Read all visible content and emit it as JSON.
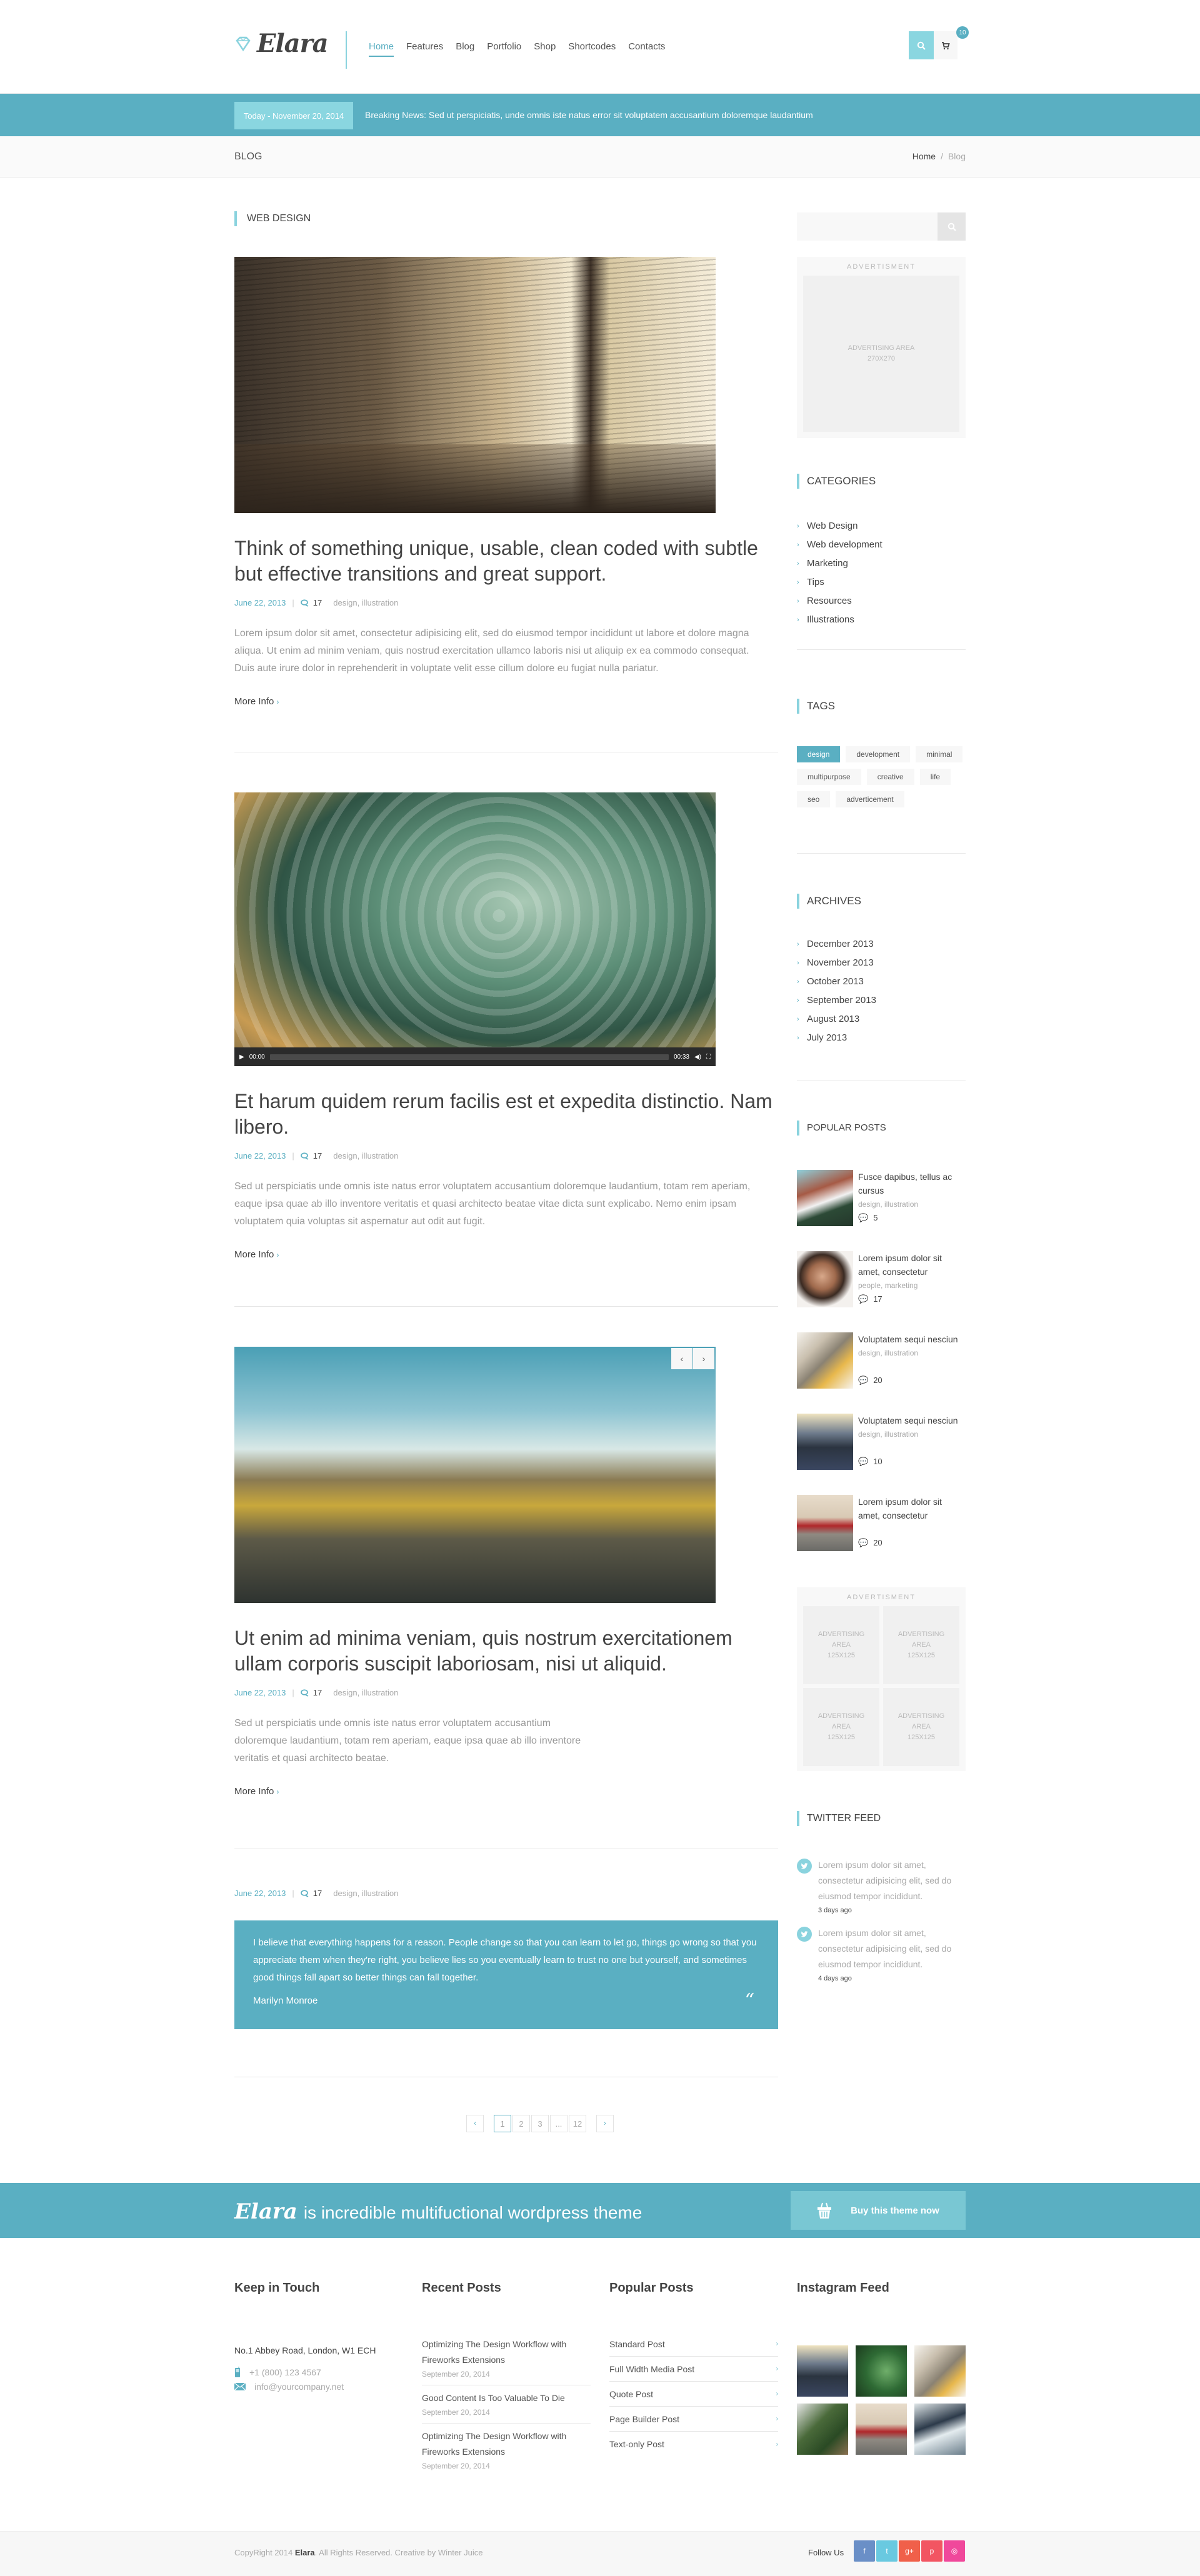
{
  "header": {
    "logo_text": "Elara",
    "nav": [
      "Home",
      "Features",
      "Blog",
      "Portfolio",
      "Shop",
      "Shortcodes",
      "Contacts"
    ],
    "active_nav": "Home",
    "cart_count": "10"
  },
  "news": {
    "today": "Today - November 20, 2014",
    "breaking": "Breaking News: Sed ut perspiciatis, unde omnis iste natus error sit voluptatem accusantium doloremque laudantium"
  },
  "titlebar": {
    "title": "BLOG",
    "breadcrumb": [
      "Home",
      "Blog"
    ],
    "separator": "/"
  },
  "main": {
    "section_title": "WEB DESIGN",
    "more_label": "More Info",
    "posts": [
      {
        "title": "Think of something unique, usable, clean coded with subtle but effective transitions and great support.",
        "date": "June 22, 2013",
        "comments": "17",
        "tags": "design, illustration",
        "excerpt": "Lorem ipsum dolor sit amet, consectetur adipisicing elit, sed do eiusmod tempor incididunt ut labore et dolore magna aliqua. Ut enim ad minim veniam, quis nostrud exercitation ullamco laboris nisi ut aliquip ex ea commodo consequat. Duis aute irure dolor in reprehenderit in voluptate velit esse cillum dolore eu fugiat nulla pariatur."
      },
      {
        "title": "Et harum quidem rerum facilis est et expedita distinctio. Nam libero.",
        "date": "June 22, 2013",
        "comments": "17",
        "tags": "design, illustration",
        "excerpt": "Sed ut perspiciatis unde omnis iste natus error voluptatem accusantium doloremque laudantium, totam rem aperiam, eaque ipsa quae ab illo inventore veritatis et quasi architecto beatae  vitae dicta sunt explicabo. Nemo enim ipsam voluptatem quia voluptas sit aspernatur aut odit aut fugit.",
        "video": {
          "current": "00:00",
          "duration": "00:33",
          "progress": 0
        }
      },
      {
        "title": "Ut enim ad minima veniam, quis nostrum exercitationem ullam corporis suscipit laboriosam, nisi ut aliquid.",
        "date": "June 22, 2013",
        "comments": "17",
        "tags": "design, illustration",
        "excerpt": "Sed ut perspiciatis unde omnis iste natus error voluptatem accusantium doloremque laudantium, totam rem aperiam, eaque ipsa quae ab illo inventore veritatis et quasi architecto beatae."
      },
      {
        "date": "June 22, 2013",
        "comments": "17",
        "tags": "design, illustration",
        "quote": "I believe that everything happens for a reason. People change so that you can learn to let go, things go wrong so that you appreciate them when they're right, you believe lies so you eventually learn to trust no one but yourself, and sometimes good things fall apart so better things can fall together.",
        "author": "Marilyn Monroe"
      }
    ],
    "pagination": {
      "prev": "‹",
      "pages": [
        "1",
        "2",
        "3",
        "...",
        "12"
      ],
      "current": "1",
      "next": "›"
    }
  },
  "sidebar": {
    "search_placeholder": "",
    "ad_label": "ADVERTISMENT",
    "ad_big": [
      "ADVERTISING AREA",
      "270X270"
    ],
    "ad_small": [
      "ADVERTISING",
      "AREA",
      "125X125"
    ],
    "categories_title": "CATEGORIES",
    "categories": [
      "Web Design",
      "Web development",
      "Marketing",
      "Tips",
      "Resources",
      "Illustrations"
    ],
    "tags_title": "TAGS",
    "tags": [
      "design",
      "development",
      "minimal",
      "multipurpose",
      "creative",
      "life",
      "seo",
      "adverticement"
    ],
    "active_tag": "design",
    "archives_title": "ARCHIVES",
    "archives": [
      "December 2013",
      "November 2013",
      "October 2013",
      "September 2013",
      "August 2013",
      "July 2013"
    ],
    "popular_title": "POPULAR POSTS",
    "popular": [
      {
        "title": "Fusce dapibus, tellus ac cursus",
        "cat": "design, illustration",
        "comments": "5"
      },
      {
        "title": "Lorem ipsum dolor sit amet, consectetur",
        "cat": "people, marketing",
        "comments": "17"
      },
      {
        "title": "Voluptatem sequi nesciun",
        "cat": "design, illustration",
        "comments": "20"
      },
      {
        "title": "Voluptatem sequi nesciun",
        "cat": "design, illustration",
        "comments": "10"
      },
      {
        "title": "Lorem ipsum dolor sit amet, consectetur",
        "cat": "",
        "comments": "20"
      }
    ],
    "twitter_title": "TWITTER FEED",
    "tweets": [
      {
        "text": "Lorem ipsum dolor sit amet, consectetur adipisicing elit, sed do eiusmod tempor incididunt.",
        "ago": "3 days ago"
      },
      {
        "text": "Lorem ipsum dolor sit amet, consectetur adipisicing elit, sed do eiusmod tempor incididunt.",
        "ago": "4 days ago"
      }
    ]
  },
  "cta": {
    "brand": "Elara",
    "text": "is incredible multifuctional wordpress theme",
    "button": "Buy this theme now"
  },
  "footer": {
    "touch_title": "Keep in Touch",
    "address": "No.1 Abbey Road, London, W1 ECH",
    "phone": "+1 (800) 123 4567",
    "email": "info@yourcompany.net",
    "recent_title": "Recent Posts",
    "recent": [
      {
        "title": "Optimizing The Design Workflow with Fireworks Extensions",
        "date": "September 20, 2014"
      },
      {
        "title": "Good Content Is Too Valuable To Die",
        "date": "September 20, 2014"
      },
      {
        "title": "Optimizing The Design Workflow with Fireworks Extensions",
        "date": "September 20, 2014"
      }
    ],
    "popular_title": "Popular Posts",
    "popular": [
      "Standard Post",
      "Full Width Media Post",
      "Quote Post",
      "Page Builder Post",
      "Text-only Post"
    ],
    "instagram_title": "Instagram Feed",
    "copyright_pre": "CopyRight 2014",
    "copyright_brand": "Elara",
    "copyright_post": ". All Rights Reserved. Creative by Winter Juice",
    "follow": "Follow Us",
    "social": [
      {
        "name": "facebook",
        "glyph": "f",
        "color": "#6a8fc7"
      },
      {
        "name": "twitter",
        "glyph": "t",
        "color": "#69c9e0"
      },
      {
        "name": "google-plus",
        "glyph": "g+",
        "color": "#f0604a"
      },
      {
        "name": "pinterest",
        "glyph": "p",
        "color": "#f25562"
      },
      {
        "name": "dribbble",
        "glyph": "◎",
        "color": "#f0489b"
      }
    ]
  }
}
